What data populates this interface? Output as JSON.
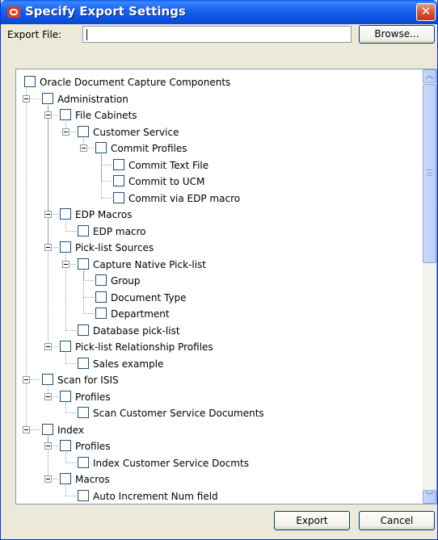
{
  "window": {
    "title": "Specify Export Settings",
    "close_symbol": "✕"
  },
  "export_file": {
    "label": "Export File:",
    "value": ""
  },
  "buttons": {
    "browse": "Browse...",
    "export": "Export",
    "cancel": "Cancel"
  },
  "tree": {
    "items": [
      {
        "label": "Oracle Document Capture Components",
        "level": 0,
        "expander": false,
        "checked": false
      },
      {
        "label": "Administration",
        "level": 1,
        "expander": true,
        "checked": false
      },
      {
        "label": "File Cabinets",
        "level": 2,
        "expander": true,
        "checked": false
      },
      {
        "label": "Customer Service",
        "level": 3,
        "expander": true,
        "checked": false
      },
      {
        "label": "Commit Profiles",
        "level": 4,
        "expander": true,
        "checked": false
      },
      {
        "label": "Commit Text File",
        "level": 5,
        "expander": false,
        "checked": false
      },
      {
        "label": "Commit to UCM",
        "level": 5,
        "expander": false,
        "checked": false
      },
      {
        "label": "Commit via EDP macro",
        "level": 5,
        "expander": false,
        "checked": false
      },
      {
        "label": "EDP Macros",
        "level": 2,
        "expander": true,
        "checked": false
      },
      {
        "label": "EDP macro",
        "level": 3,
        "expander": false,
        "checked": false
      },
      {
        "label": "Pick-list Sources",
        "level": 2,
        "expander": true,
        "checked": false
      },
      {
        "label": "Capture Native Pick-list",
        "level": 3,
        "expander": true,
        "checked": false
      },
      {
        "label": "Group",
        "level": 4,
        "expander": false,
        "checked": false
      },
      {
        "label": "Document Type",
        "level": 4,
        "expander": false,
        "checked": false
      },
      {
        "label": "Department",
        "level": 4,
        "expander": false,
        "checked": false
      },
      {
        "label": "Database pick-list",
        "level": 3,
        "expander": false,
        "checked": false
      },
      {
        "label": "Pick-list Relationship Profiles",
        "level": 2,
        "expander": true,
        "checked": false
      },
      {
        "label": "Sales example",
        "level": 3,
        "expander": false,
        "checked": false
      },
      {
        "label": "Scan for ISIS",
        "level": 1,
        "expander": true,
        "checked": false
      },
      {
        "label": "Profiles",
        "level": 2,
        "expander": true,
        "checked": false
      },
      {
        "label": "Scan Customer Service Documents",
        "level": 3,
        "expander": false,
        "checked": false
      },
      {
        "label": "Index",
        "level": 1,
        "expander": true,
        "checked": false
      },
      {
        "label": "Profiles",
        "level": 2,
        "expander": true,
        "checked": false
      },
      {
        "label": "Index Customer Service Docmts",
        "level": 3,
        "expander": false,
        "checked": false
      },
      {
        "label": "Macros",
        "level": 2,
        "expander": true,
        "checked": false
      },
      {
        "label": "Auto Increment Num field",
        "level": 3,
        "expander": false,
        "checked": false
      }
    ]
  },
  "scrollbar": {
    "up_symbol": "︿",
    "down_symbol": "﹀",
    "position": 0
  },
  "icons": {
    "title_logo": "oracle-logo-icon",
    "close": "close-icon",
    "scroll_up": "chevron-up-icon",
    "scroll_down": "chevron-down-icon"
  }
}
